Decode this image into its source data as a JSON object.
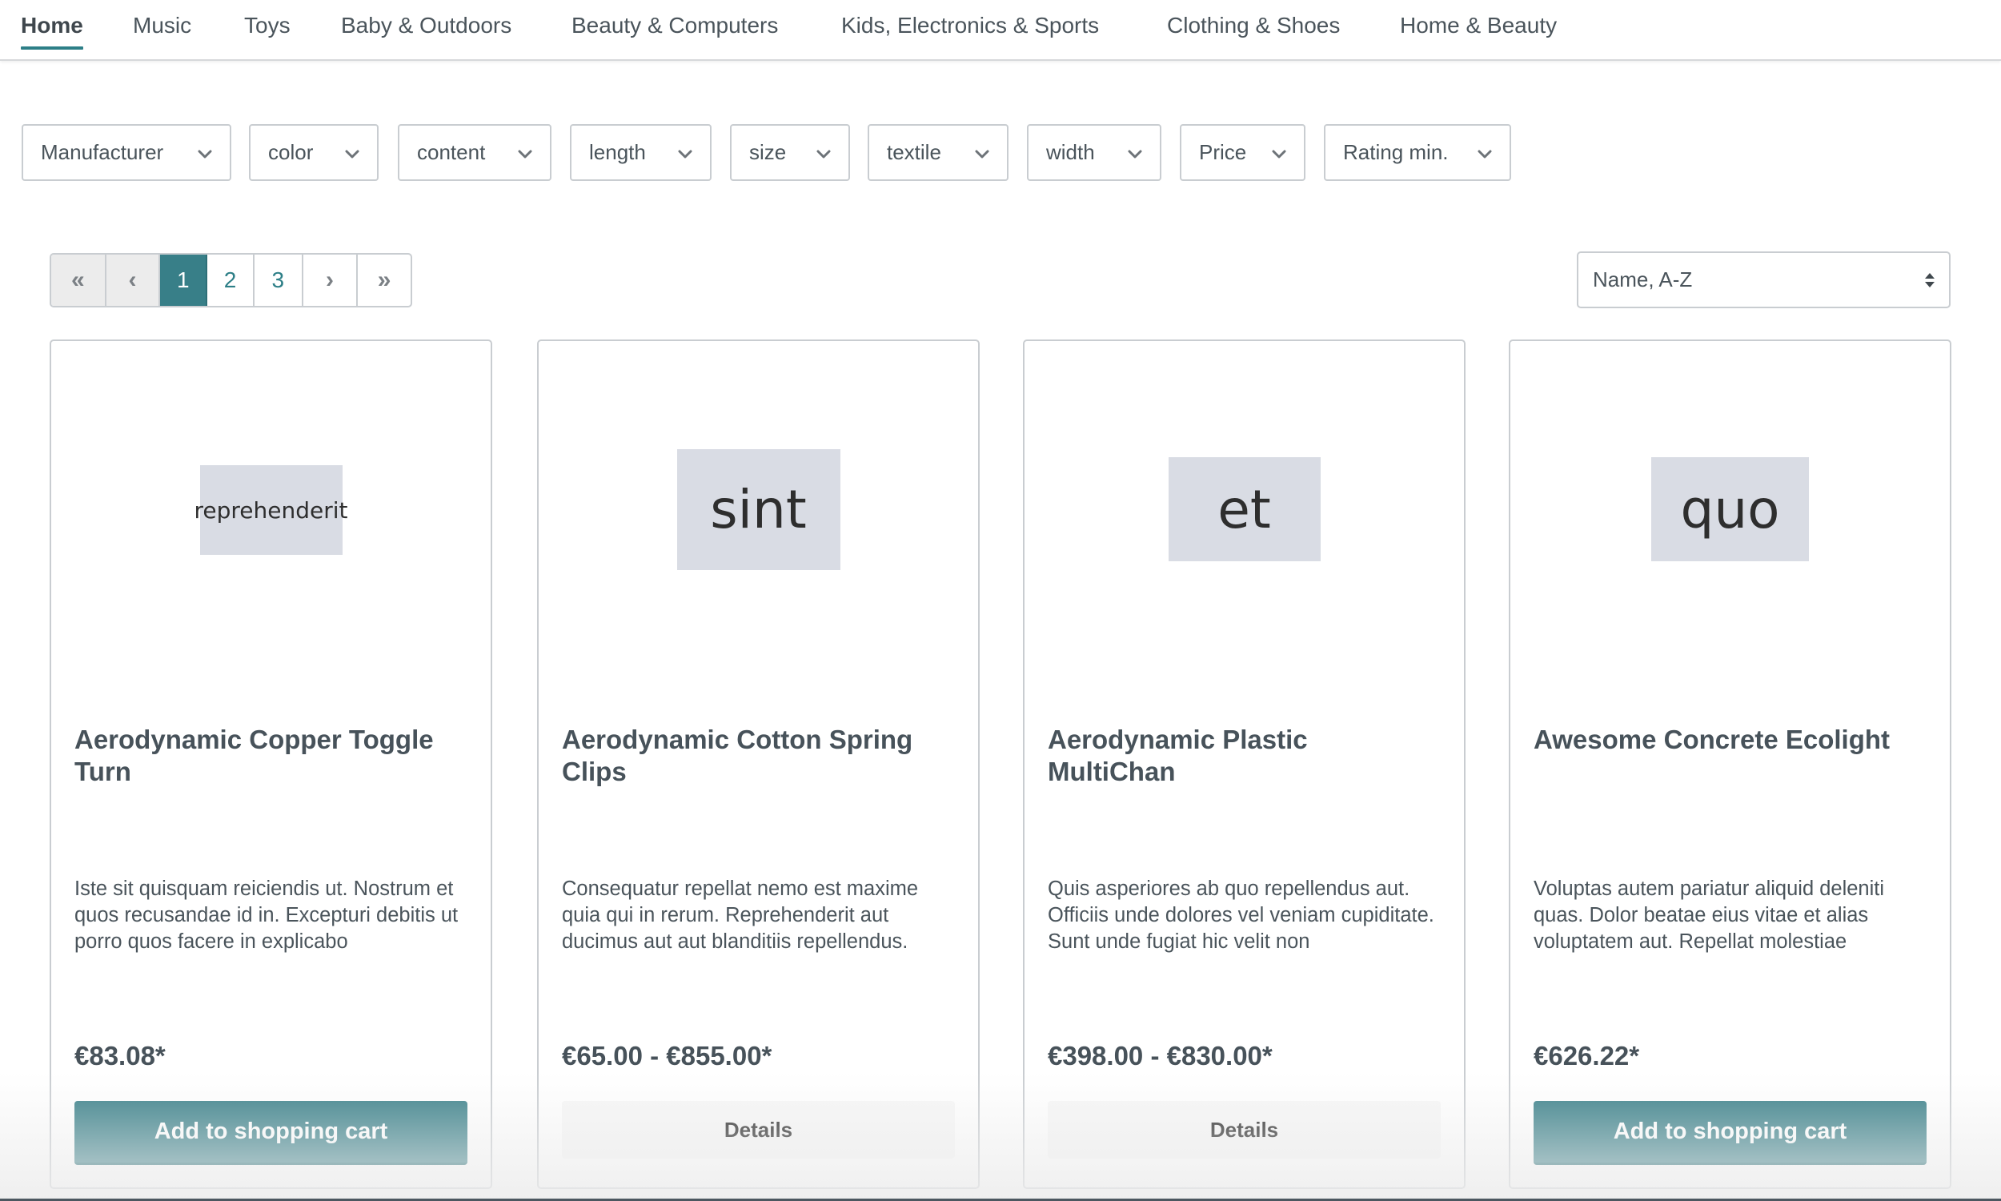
{
  "nav": {
    "tabs": [
      {
        "label": "Home",
        "active": true
      },
      {
        "label": "Music"
      },
      {
        "label": "Toys"
      },
      {
        "label": "Baby & Outdoors"
      },
      {
        "label": "Beauty & Computers"
      },
      {
        "label": "Kids, Electronics & Sports"
      },
      {
        "label": "Clothing & Shoes"
      },
      {
        "label": "Home & Beauty"
      }
    ]
  },
  "filters": [
    {
      "label": "Manufacturer",
      "icon": "chevron-down-icon"
    },
    {
      "label": "color",
      "icon": "chevron-down-icon"
    },
    {
      "label": "content",
      "icon": "chevron-down-icon"
    },
    {
      "label": "length",
      "icon": "chevron-down-icon"
    },
    {
      "label": "size",
      "icon": "chevron-down-icon"
    },
    {
      "label": "textile",
      "icon": "chevron-down-icon"
    },
    {
      "label": "width",
      "icon": "chevron-down-icon"
    },
    {
      "label": "Price",
      "icon": "chevron-down-icon"
    },
    {
      "label": "Rating min.",
      "icon": "chevron-down-icon"
    }
  ],
  "pagination": {
    "first": "«",
    "prev": "‹",
    "pages": [
      "1",
      "2",
      "3"
    ],
    "current_page": "1",
    "next": "›",
    "last": "»"
  },
  "sort": {
    "selected": "Name, A-Z",
    "icon": "sort-updown-icon"
  },
  "products": [
    {
      "image_text": "reprehenderit",
      "name": "Aerodynamic Copper Toggle Turn",
      "description": "Iste sit quisquam reiciendis ut. Nostrum et quos recusandae id in. Excepturi debitis ut porro quos facere in explicabo",
      "price": "€83.08*",
      "button": "Add to shopping cart",
      "button_type": "primary"
    },
    {
      "image_text": "sint",
      "name": "Aerodynamic Cotton Spring Clips",
      "description": "Consequatur repellat nemo est maxime quia qui in rerum. Reprehenderit aut ducimus aut aut blanditiis repellendus.",
      "price": "€65.00 - €855.00*",
      "button": "Details",
      "button_type": "secondary"
    },
    {
      "image_text": "et",
      "name": "Aerodynamic Plastic MultiChan",
      "description": "Quis asperiores ab quo repellendus aut. Officiis unde dolores vel veniam cupiditate. Sunt unde fugiat hic velit non",
      "price": "€398.00 - €830.00*",
      "button": "Details",
      "button_type": "secondary"
    },
    {
      "image_text": "quo",
      "name": "Awesome Concrete Ecolight",
      "description": "Voluptas autem pariatur aliquid deleniti quas. Dolor beatae eius vitae et alias voluptatem aut. Repellat molestiae",
      "price": "€626.22*",
      "button": "Add to shopping cart",
      "button_type": "primary"
    }
  ],
  "colors": {
    "accent": "#387f88",
    "accent_dark": "#1f6a72",
    "border": "#c9cdd1",
    "placeholder_bg": "#d9dce4",
    "text": "#4a545b"
  }
}
